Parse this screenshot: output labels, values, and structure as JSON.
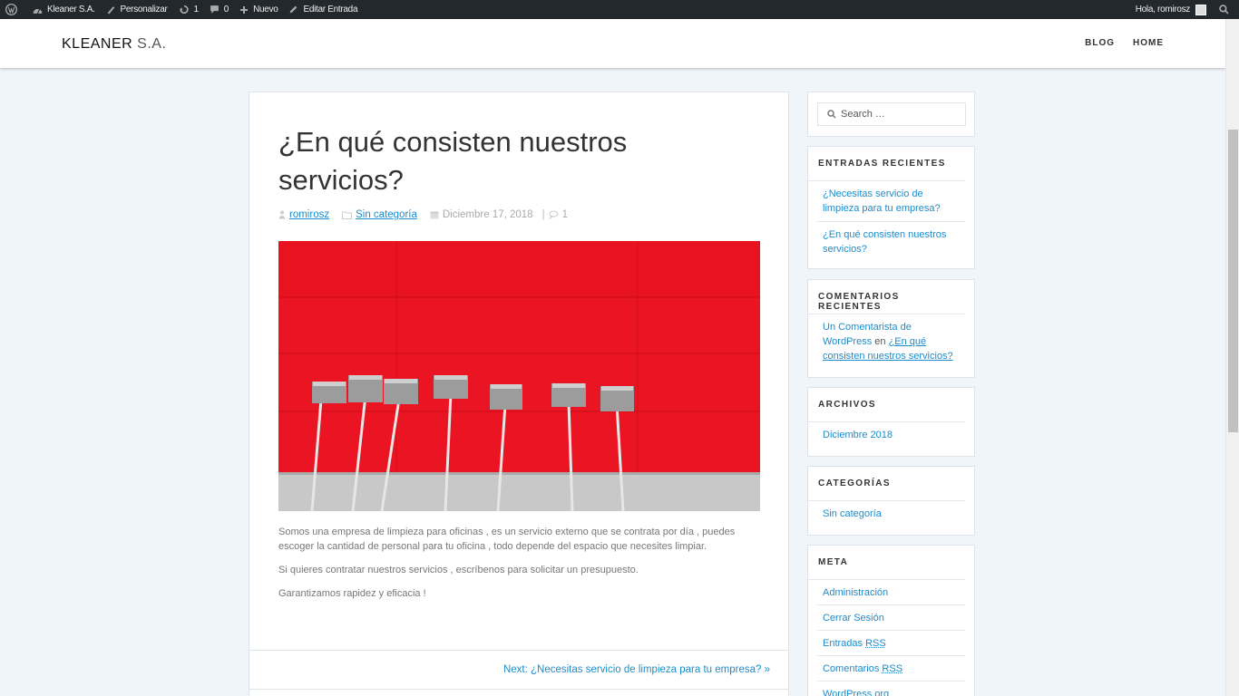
{
  "adminbar": {
    "items": [
      {
        "label": "",
        "icon": "wordpress-icon"
      },
      {
        "label": "Kleaner S.A.",
        "icon": "dashboard-icon"
      },
      {
        "label": "Personalizar",
        "icon": "brush-icon"
      },
      {
        "label": "1",
        "icon": "updates-icon"
      },
      {
        "label": "0",
        "icon": "comment-icon"
      },
      {
        "label": "Nuevo",
        "icon": "plus-icon"
      },
      {
        "label": "Editar Entrada",
        "icon": "pencil-icon"
      }
    ],
    "greeting": "Hola, romirosz"
  },
  "header": {
    "site_title_main": "KLEANER",
    "site_title_tail": " S.A.",
    "nav": [
      "BLOG",
      "HOME"
    ]
  },
  "article": {
    "title": "¿En qué consisten nuestros servicios?",
    "author": "romirosz",
    "category": "Sin categoría",
    "date": "Diciembre 17, 2018",
    "comments": "1",
    "paragraphs": [
      "Somos una empresa de limpieza para oficinas , es un servicio externo que se contrata por día , puedes escoger la cantidad de personal para tu oficina , todo depende del espacio que necesites limpiar.",
      "Si quieres contratar nuestros servicios , escríbenos para solicitar un presupuesto.",
      "Garantizamos rapidez y eficacia !"
    ],
    "next_link": "Next: ¿Necesitas servicio de limpieza para tu empresa?"
  },
  "sidebar": {
    "search": {
      "placeholder": "Search …"
    },
    "recent_posts": {
      "title": "ENTRADAS RECIENTES",
      "items": [
        "¿Necesitas servicio de limpieza para tu empresa?",
        "¿En qué consisten nuestros servicios?"
      ]
    },
    "recent_comments": {
      "title": "COMENTARIOS RECIENTES",
      "author": "Un Comentarista de WordPress",
      "connector": " en ",
      "post": "¿En qué consisten nuestros servicios?"
    },
    "archives": {
      "title": "ARCHIVOS",
      "items": [
        "Diciembre 2018"
      ]
    },
    "categories": {
      "title": "CATEGORÍAS",
      "items": [
        "Sin categoría"
      ]
    },
    "meta": {
      "title": "META",
      "items": [
        "Administración",
        "Cerrar Sesión"
      ],
      "entries_rss_prefix": "Entradas ",
      "comments_rss_prefix": "Comentarios ",
      "rss": "RSS",
      "wordpress_org": "WordPress.org"
    }
  },
  "colors": {
    "accent": "#1c8ccb",
    "adminbar": "#23282d",
    "background": "#f0f5fa",
    "image_red": "#ea1422"
  }
}
